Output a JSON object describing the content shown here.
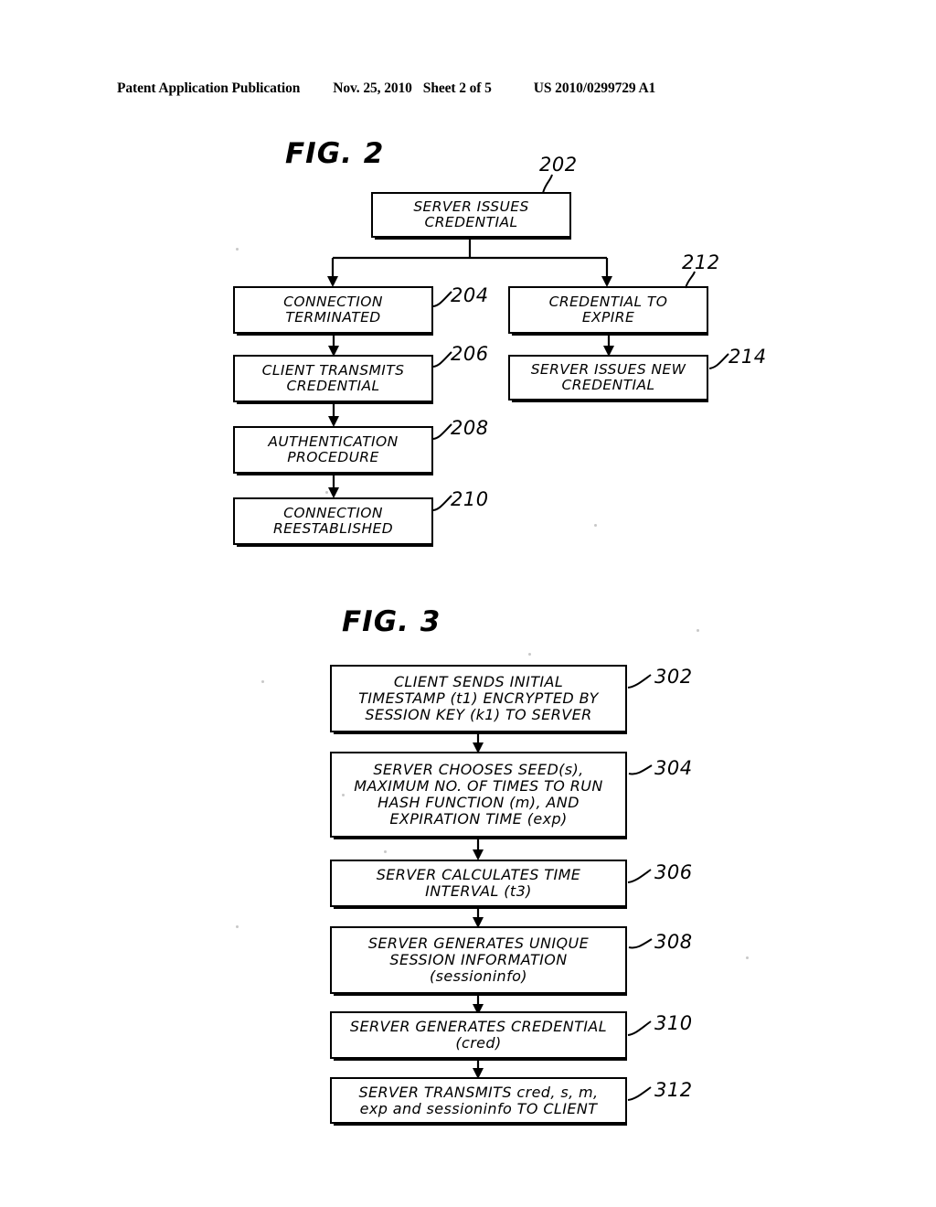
{
  "header": {
    "publication": "Patent Application Publication",
    "date": "Nov. 25, 2010",
    "sheet": "Sheet 2 of 5",
    "document_number": "US 2010/0299729 A1"
  },
  "figures": [
    {
      "title": "FIG. 2",
      "boxes": [
        {
          "ref": "202",
          "lines": [
            "SERVER  ISSUES",
            "CREDENTIAL"
          ]
        },
        {
          "ref": "204",
          "lines": [
            "CONNECTION",
            "TERMINATED"
          ]
        },
        {
          "ref": "206",
          "lines": [
            "CLIENT  TRANSMITS",
            "CREDENTIAL"
          ]
        },
        {
          "ref": "208",
          "lines": [
            "AUTHENTICATION",
            "PROCEDURE"
          ]
        },
        {
          "ref": "210",
          "lines": [
            "CONNECTION",
            "REESTABLISHED"
          ]
        },
        {
          "ref": "212",
          "lines": [
            "CREDENTIAL  TO",
            "EXPIRE"
          ]
        },
        {
          "ref": "214",
          "lines": [
            "SERVER ISSUES NEW",
            "CREDENTIAL"
          ]
        }
      ]
    },
    {
      "title": "FIG. 3",
      "boxes": [
        {
          "ref": "302",
          "lines": [
            "CLIENT  SENDS  INITIAL",
            "TIMESTAMP  (t1)  ENCRYPTED  BY",
            "SESSION  KEY  (k1)  TO  SERVER"
          ]
        },
        {
          "ref": "304",
          "lines": [
            "SERVER  CHOOSES  SEED(s),",
            "MAXIMUM NO. OF TIMES TO RUN",
            "HASH  FUNCTION  (m),  AND",
            "EXPIRATION  TIME  (exp)"
          ]
        },
        {
          "ref": "306",
          "lines": [
            "SERVER  CALCULATES  TIME",
            "INTERVAL  (t3)"
          ]
        },
        {
          "ref": "308",
          "lines": [
            "SERVER GENERATES UNIQUE",
            "SESSION  INFORMATION",
            "(sessioninfo)"
          ]
        },
        {
          "ref": "310",
          "lines": [
            "SERVER  GENERATES  CREDENTIAL",
            "(cred)"
          ]
        },
        {
          "ref": "312",
          "lines": [
            "SERVER  TRANSMITS  cred,  s,  m,",
            "exp  and  sessioninfo  TO  CLIENT"
          ]
        }
      ]
    }
  ]
}
